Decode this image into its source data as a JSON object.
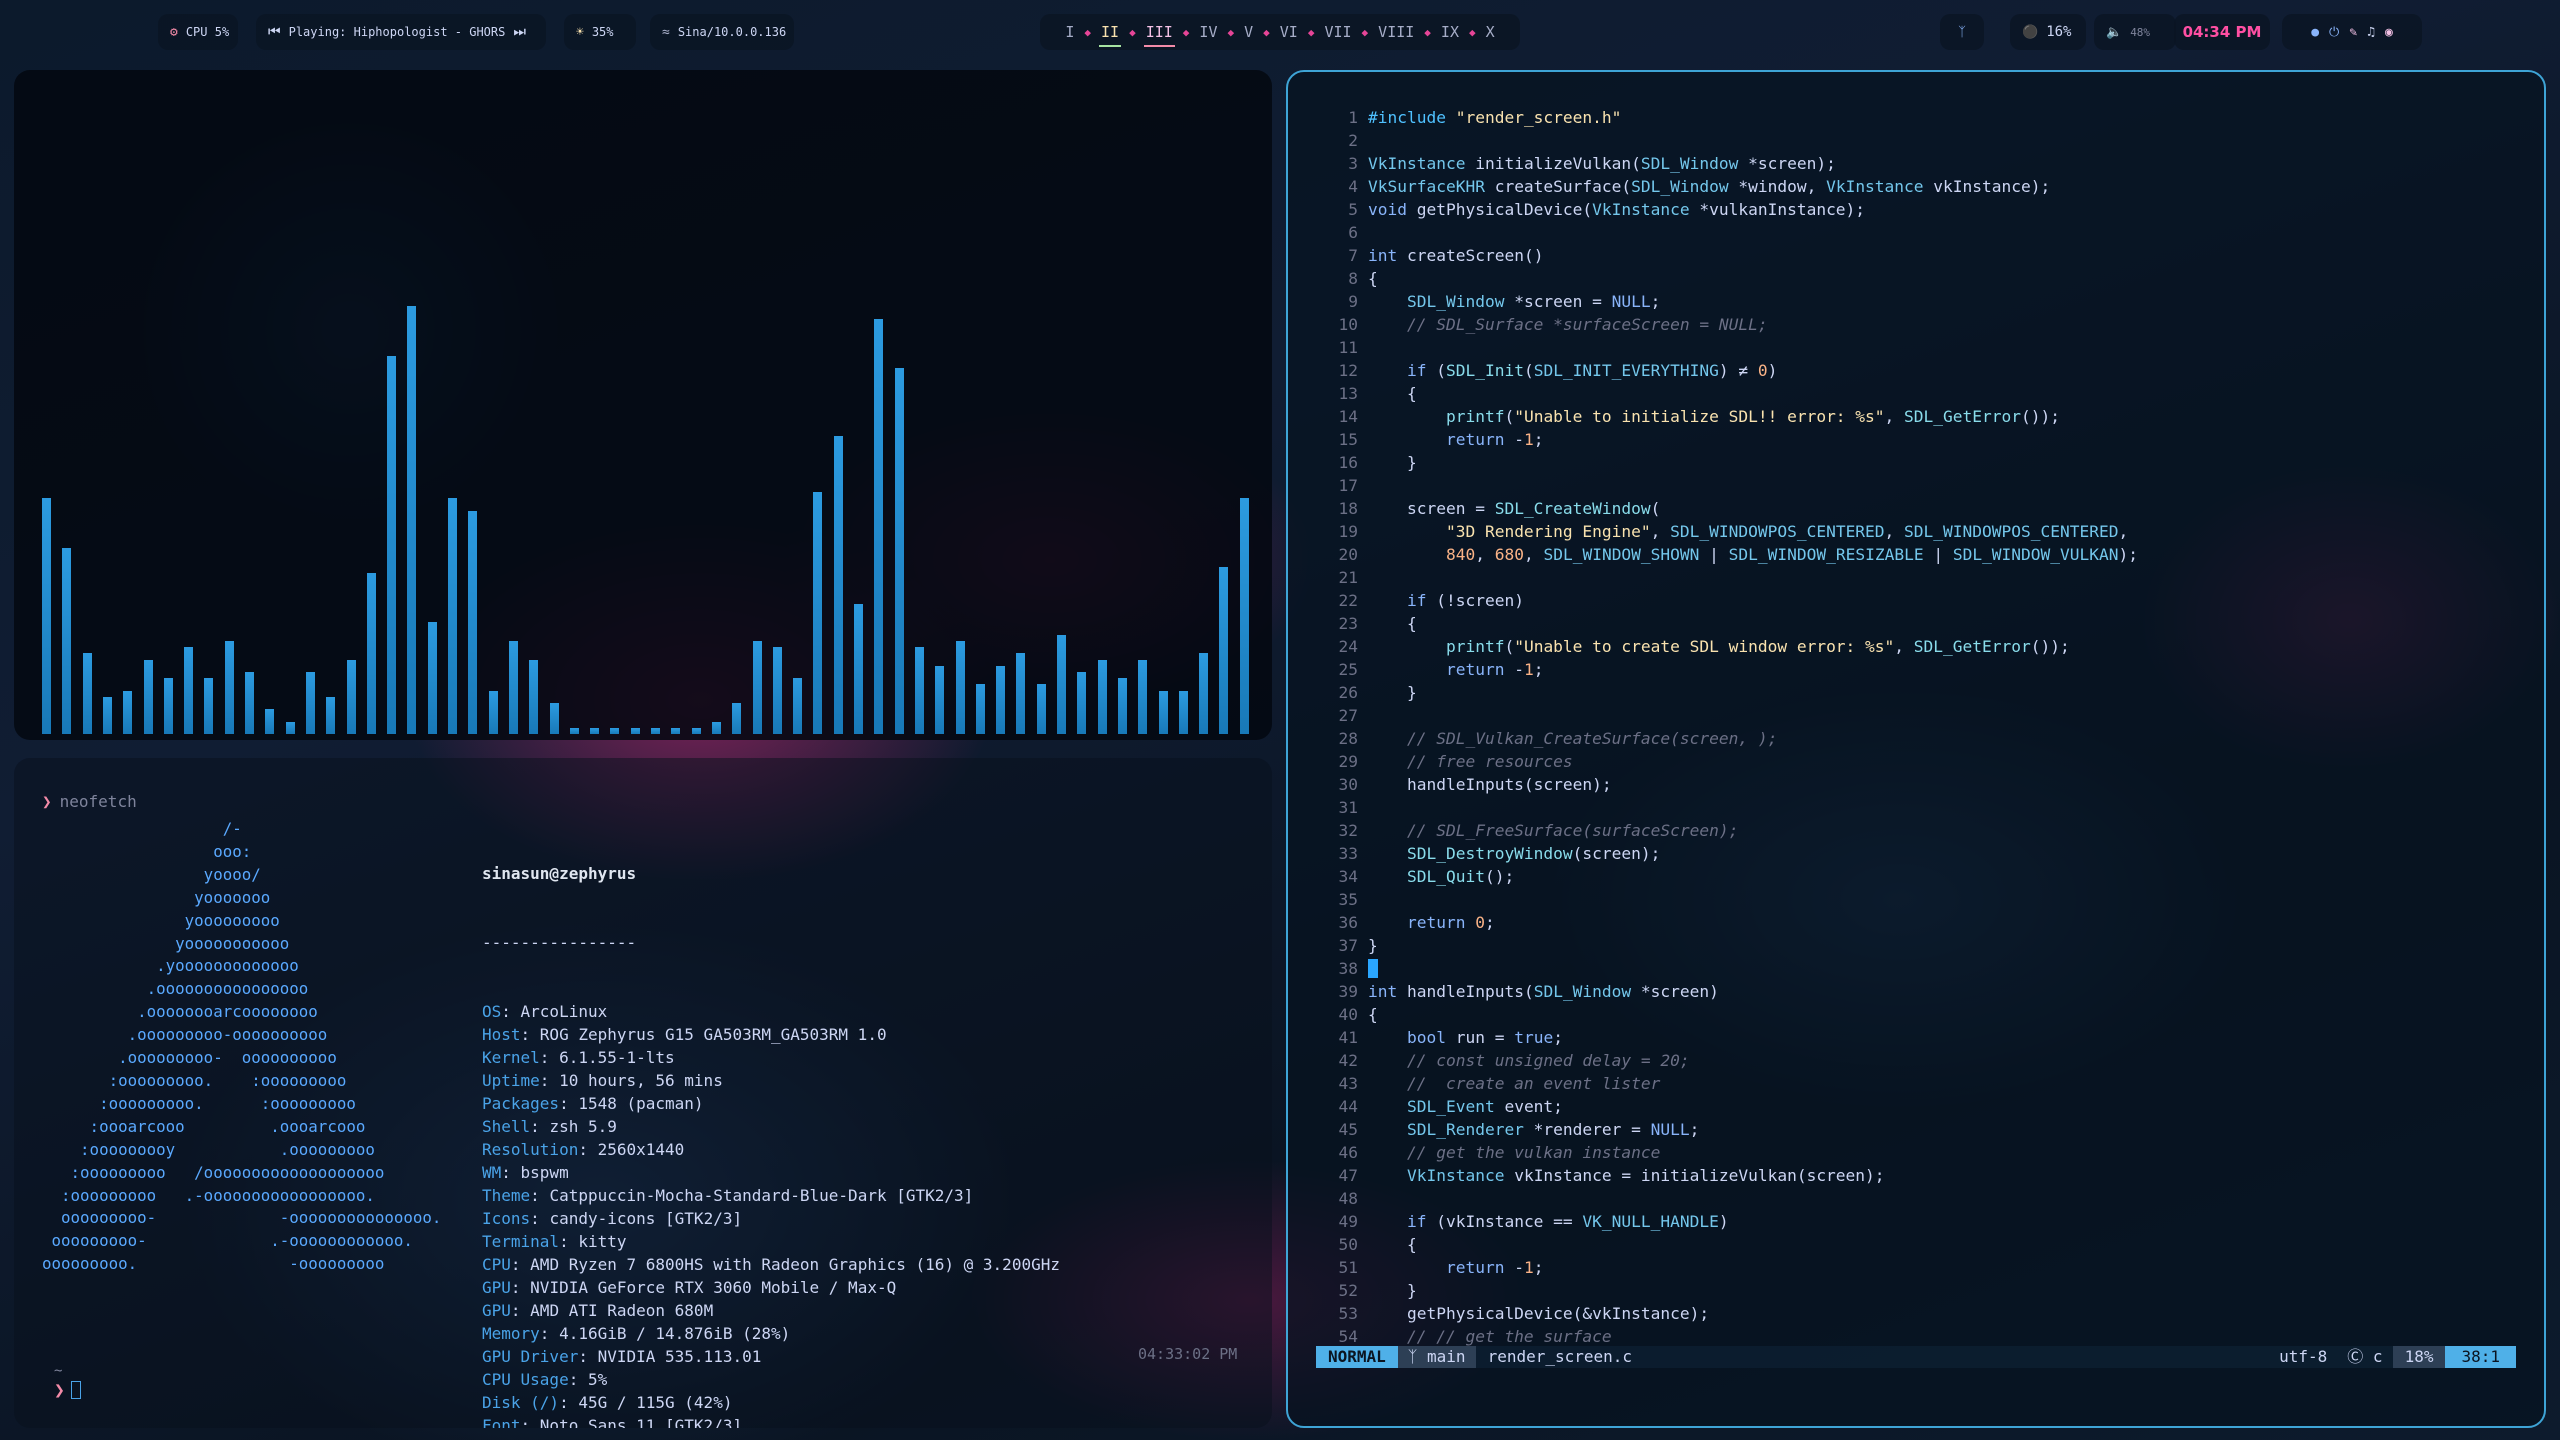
{
  "topbar": {
    "cpu": "CPU 5%",
    "playing": "Playing: Hiphopologist - GHORS",
    "brightness": "35%",
    "network": "Sina/10.0.0.136",
    "workspaces": [
      "I",
      "II",
      "III",
      "IV",
      "V",
      "VI",
      "VII",
      "VIII",
      "IX",
      "X"
    ],
    "mic": "16%",
    "volume": "48%",
    "time": "04:34 PM"
  },
  "visualizer": {
    "bar_heights": [
      0.38,
      0.3,
      0.13,
      0.06,
      0.07,
      0.12,
      0.09,
      0.14,
      0.09,
      0.15,
      0.1,
      0.04,
      0.02,
      0.1,
      0.06,
      0.12,
      0.26,
      0.61,
      0.69,
      0.18,
      0.38,
      0.36,
      0.07,
      0.15,
      0.12,
      0.05,
      0.01,
      0.01,
      0.01,
      0.01,
      0.01,
      0.01,
      0.01,
      0.02,
      0.05,
      0.15,
      0.14,
      0.09,
      0.39,
      0.48,
      0.21,
      0.67,
      0.59,
      0.14,
      0.11,
      0.15,
      0.08,
      0.11,
      0.13,
      0.08,
      0.16,
      0.1,
      0.12,
      0.09,
      0.12,
      0.07,
      0.07,
      0.13,
      0.27,
      0.38
    ],
    "accent": "#2c9be0"
  },
  "terminal": {
    "command": "neofetch",
    "ascii": "                   /-\n                  ooo:\n                 yoooo/\n                yooooooo\n               yooooooooo\n              yooooooooooo\n            .yooooooooooooo\n           .oooooooooooooooo\n          .oooooooarcoooooooo\n         .ooooooooo-oooooooooo\n        .ooooooooo-  oooooooooo\n       :ooooooooo.    :ooooooooo\n      :ooooooooo.      :ooooooooo\n     :oooarcooo         .oooarcooo\n    :ooooooooy           .ooooooooo\n   :ooooooooo   /ooooooooooooooooooo\n  :ooooooooo   .-ooooooooooooooooo.\n  ooooooooo-             -ooooooooooooooo.\n ooooooooo-             .-oooooooooooo.\nooooooooo.                -ooooooooo",
    "user_host": "sinasun@zephyrus",
    "separator": "----------------",
    "info": [
      {
        "key": "OS",
        "value": "ArcoLinux"
      },
      {
        "key": "Host",
        "value": "ROG Zephyrus G15 GA503RM_GA503RM 1.0"
      },
      {
        "key": "Kernel",
        "value": "6.1.55-1-lts"
      },
      {
        "key": "Uptime",
        "value": "10 hours, 56 mins"
      },
      {
        "key": "Packages",
        "value": "1548 (pacman)"
      },
      {
        "key": "Shell",
        "value": "zsh 5.9"
      },
      {
        "key": "Resolution",
        "value": "2560x1440"
      },
      {
        "key": "WM",
        "value": "bspwm"
      },
      {
        "key": "Theme",
        "value": "Catppuccin-Mocha-Standard-Blue-Dark [GTK2/3]"
      },
      {
        "key": "Icons",
        "value": "candy-icons [GTK2/3]"
      },
      {
        "key": "Terminal",
        "value": "kitty"
      },
      {
        "key": "CPU",
        "value": "AMD Ryzen 7 6800HS with Radeon Graphics (16) @ 3.200GHz"
      },
      {
        "key": "GPU",
        "value": "NVIDIA GeForce RTX 3060 Mobile / Max-Q"
      },
      {
        "key": "GPU",
        "value": "AMD ATI Radeon 680M"
      },
      {
        "key": "Memory",
        "value": "4.16GiB / 14.876iB (28%)"
      },
      {
        "key": "GPU Driver",
        "value": "NVIDIA 535.113.01"
      },
      {
        "key": "CPU Usage",
        "value": "5%"
      },
      {
        "key": "Disk (/)",
        "value": "45G / 115G (42%)"
      },
      {
        "key": "Font",
        "value": "Noto Sans 11 [GTK2/3]"
      }
    ],
    "timestamp": "04:33:02 PM",
    "tilde": "~"
  },
  "editor": {
    "lines": [
      "#include \"render_screen.h\"",
      "",
      "VkInstance initializeVulkan(SDL_Window *screen);",
      "VkSurfaceKHR createSurface(SDL_Window *window, VkInstance vkInstance);",
      "void getPhysicalDevice(VkInstance *vulkanInstance);",
      "",
      "int createScreen()",
      "{",
      "    SDL_Window *screen = NULL;",
      "    // SDL_Surface *surfaceScreen = NULL;",
      "",
      "    if (SDL_Init(SDL_INIT_EVERYTHING) ≠ 0)",
      "    {",
      "        printf(\"Unable to initialize SDL!! error: %s\", SDL_GetError());",
      "        return -1;",
      "    }",
      "",
      "    screen = SDL_CreateWindow(",
      "        \"3D Rendering Engine\", SDL_WINDOWPOS_CENTERED, SDL_WINDOWPOS_CENTERED,",
      "        840, 680, SDL_WINDOW_SHOWN | SDL_WINDOW_RESIZABLE | SDL_WINDOW_VULKAN);",
      "",
      "    if (!screen)",
      "    {",
      "        printf(\"Unable to create SDL window error: %s\", SDL_GetError());",
      "        return -1;",
      "    }",
      "",
      "    // SDL_Vulkan_CreateSurface(screen, );",
      "    // free resources",
      "    handleInputs(screen);",
      "",
      "    // SDL_FreeSurface(surfaceScreen);",
      "    SDL_DestroyWindow(screen);",
      "    SDL_Quit();",
      "",
      "    return 0;",
      "}",
      "",
      "int handleInputs(SDL_Window *screen)",
      "{",
      "    bool run = true;",
      "    // const unsigned delay = 20;",
      "    //  create an event lister",
      "    SDL_Event event;",
      "    SDL_Renderer *renderer = NULL;",
      "    // get the vulkan instance",
      "    VkInstance vkInstance = initializeVulkan(screen);",
      "",
      "    if (vkInstance == VK_NULL_HANDLE)",
      "    {",
      "        return -1;",
      "    }",
      "    getPhysicalDevice(&vkInstance);",
      "    // // get the surface"
    ],
    "cursor_line": 38,
    "status": {
      "mode": "NORMAL",
      "branch": "main",
      "file": "render_screen.c",
      "encoding": "utf-8",
      "filetype": "c",
      "percent": "18%",
      "position": "38:1"
    }
  }
}
